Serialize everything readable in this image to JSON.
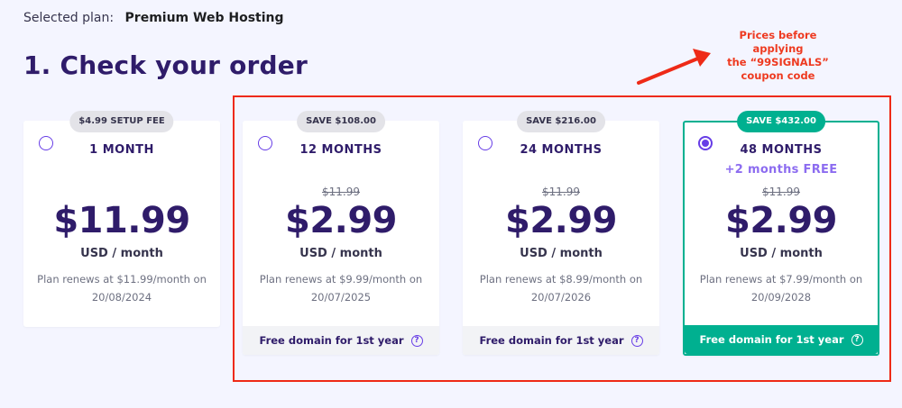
{
  "header": {
    "selected_label": "Selected plan:",
    "selected_plan": "Premium Web Hosting",
    "title": "1. Check your order"
  },
  "annotation": {
    "note_line1": "Prices before applying",
    "note_line2": "the “99SIGNALS”",
    "note_line3": "coupon code",
    "color": "#ee2a17"
  },
  "plans": [
    {
      "badge": "$4.99 SETUP FEE",
      "period": "1 MONTH",
      "extra": "",
      "old_price": "",
      "price": "$11.99",
      "unit": "USD / month",
      "renew_line1": "Plan renews at $11.99/month on",
      "renew_line2": "20/08/2024",
      "footer": "",
      "selected": false
    },
    {
      "badge": "SAVE $108.00",
      "period": "12 MONTHS",
      "extra": "",
      "old_price": "$11.99",
      "price": "$2.99",
      "unit": "USD / month",
      "renew_line1": "Plan renews at $9.99/month on",
      "renew_line2": "20/07/2025",
      "footer": "Free domain for 1st year",
      "selected": false
    },
    {
      "badge": "SAVE $216.00",
      "period": "24 MONTHS",
      "extra": "",
      "old_price": "$11.99",
      "price": "$2.99",
      "unit": "USD / month",
      "renew_line1": "Plan renews at $8.99/month on",
      "renew_line2": "20/07/2026",
      "footer": "Free domain for 1st year",
      "selected": false
    },
    {
      "badge": "SAVE $432.00",
      "period": "48 MONTHS",
      "extra": "+2 months FREE",
      "old_price": "$11.99",
      "price": "$2.99",
      "unit": "USD / month",
      "renew_line1": "Plan renews at $7.99/month on",
      "renew_line2": "20/09/2028",
      "footer": "Free domain for 1st year",
      "selected": true
    }
  ],
  "help_icon": "question-circle-icon",
  "colors": {
    "accent": "#673de6",
    "heading": "#2f1c6a",
    "selected_border": "#00b090",
    "background": "#f4f5ff"
  }
}
